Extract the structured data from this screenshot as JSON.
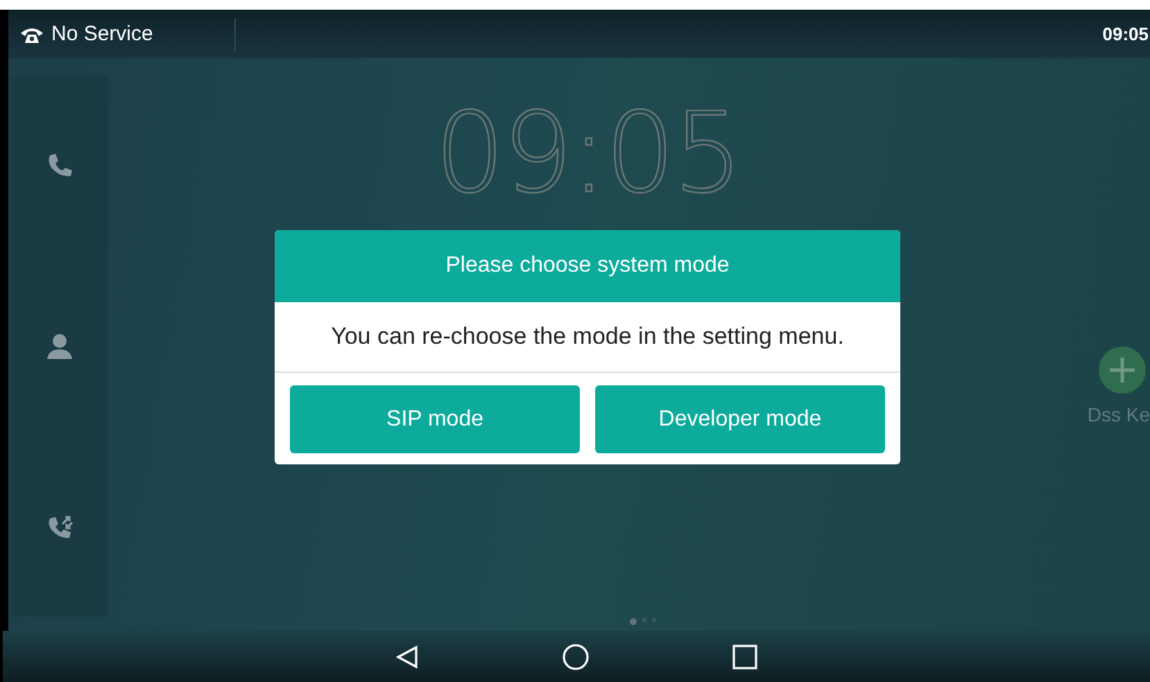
{
  "status_bar": {
    "account": "No Service",
    "time": "09:05"
  },
  "sidebar": {
    "items": [
      {
        "kind": "phone"
      },
      {
        "kind": "contact"
      },
      {
        "kind": "history"
      }
    ]
  },
  "clock": "09:05",
  "dss_key": {
    "label": "Dss Ke"
  },
  "pages": [
    {
      "selected": true
    },
    {
      "selected": false
    },
    {
      "selected": false
    }
  ],
  "dialog": {
    "title": "Please choose system mode",
    "message": "You can re-choose the mode in the setting menu.",
    "buttons": [
      "SIP mode",
      "Developer mode"
    ]
  },
  "nav_bar": [
    {
      "kind": "back"
    },
    {
      "kind": "home"
    },
    {
      "kind": "recents"
    }
  ]
}
